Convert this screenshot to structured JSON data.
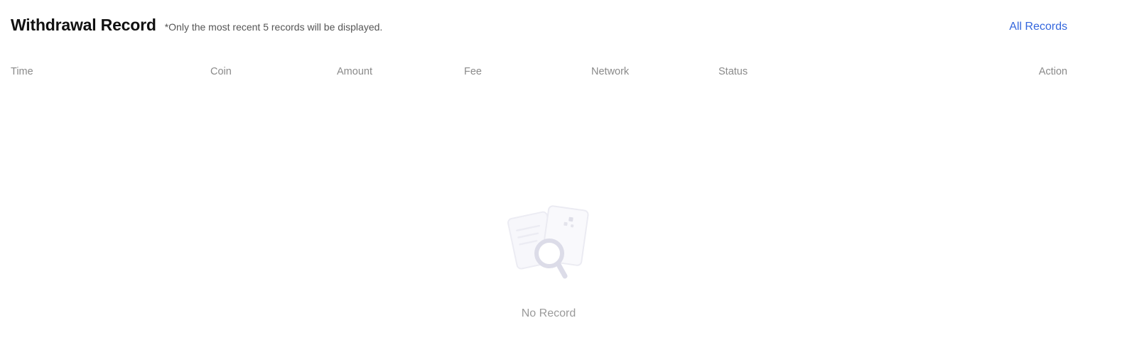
{
  "header": {
    "title": "Withdrawal Record",
    "subtitle": "*Only the most recent 5 records will be displayed.",
    "all_records_label": "All Records"
  },
  "table": {
    "columns": [
      "Time",
      "Coin",
      "Amount",
      "Fee",
      "Network",
      "Status",
      "Action"
    ],
    "rows": []
  },
  "empty_state": {
    "icon": "no-record-search-icon",
    "text": "No Record"
  },
  "colors": {
    "accent": "#3366dd",
    "header_text": "#8a8a8a",
    "empty_text": "#9a9a9a"
  }
}
